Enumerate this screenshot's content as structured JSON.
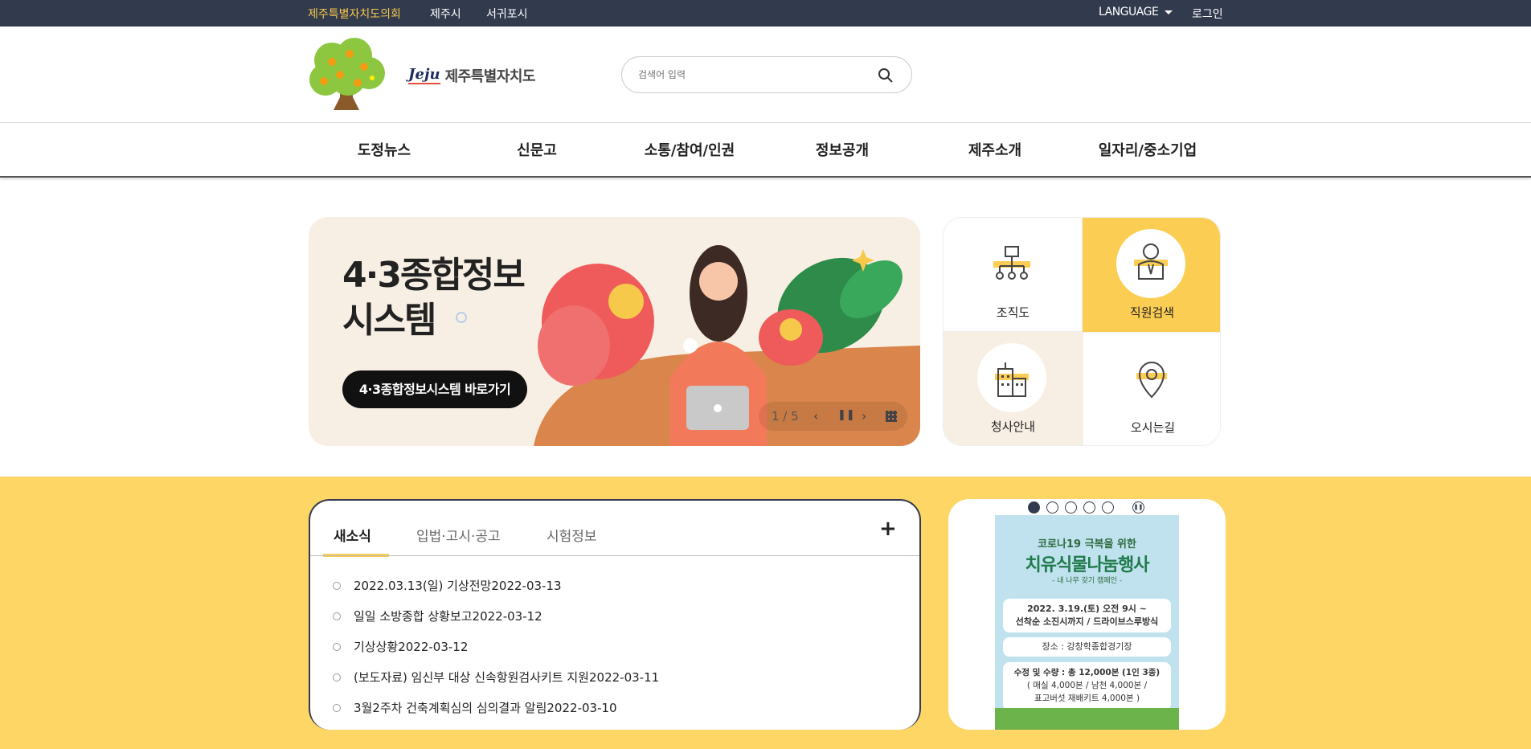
{
  "topbar": {
    "links": [
      "제주특별자치도의회",
      "제주시",
      "서귀포시"
    ],
    "language_label": "LANGUAGE",
    "login_label": "로그인",
    "accent_color": "#f5c84b"
  },
  "header": {
    "logo_text": "제주특별자치도",
    "logo_brand": "Jeju",
    "search_placeholder": "검색어 입력"
  },
  "gnb": {
    "items": [
      "도정뉴스",
      "신문고",
      "소통/참여/인권",
      "정보공개",
      "제주소개",
      "일자리/중소기업"
    ]
  },
  "banner": {
    "title_line1": "4·3종합정보",
    "title_line2": "시스템",
    "button_label": "4·3종합정보시스템 바로가기",
    "pager": "1 / 5"
  },
  "quick": [
    {
      "label": "조직도",
      "icon": "org-chart-icon"
    },
    {
      "label": "직원검색",
      "icon": "staff-search-icon"
    },
    {
      "label": "청사안내",
      "icon": "building-icon"
    },
    {
      "label": "오시는길",
      "icon": "location-pin-icon"
    }
  ],
  "news": {
    "tabs": [
      "새소식",
      "입법·고시·공고",
      "시험정보"
    ],
    "more_label": "+",
    "items": [
      "2022.03.13(일) 기상전망2022-03-13",
      "일일 소방종합 상황보고2022-03-12",
      "기상상황2022-03-12",
      "(보도자료) 임신부 대상 신속항원검사키트 지원2022-03-11",
      "3월2주차 건축계획심의 심의결과 알림2022-03-10"
    ]
  },
  "promo": {
    "headline1": "코로나19 극복을 위한",
    "headline2": "치유식물나눔행사",
    "subtitle": "- 내 나무 갖기 캠페인 -",
    "date_line1": "2022. 3.19.(토) 오전 9시 ~",
    "date_line2": "선착순 소진시까지 / 드라이브스루방식",
    "place": "장소 : 강창학종합경기장",
    "qty_line1": "수정 및 수량 : 총 12,000본 (1인 3종)",
    "qty_line2": "( 매실 4,000본 / 남천 4,000본 /",
    "qty_line3": "표고버섯 재배키트 4,000본 )"
  },
  "colors": {
    "navy": "#323a4e",
    "yellow": "#fdd666",
    "quick_highlight": "#fbcd53"
  }
}
